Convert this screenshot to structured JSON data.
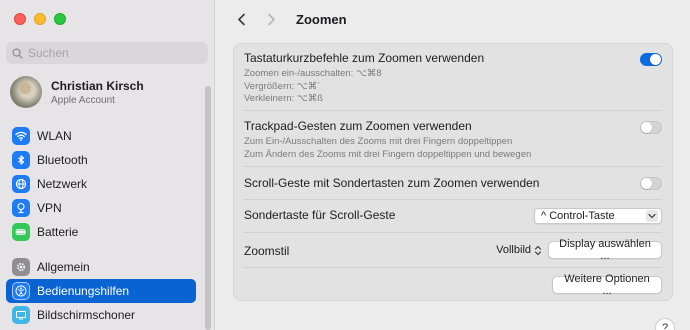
{
  "window": {
    "controls": [
      "close",
      "minimize",
      "zoom"
    ]
  },
  "sidebar": {
    "search": {
      "placeholder": "Suchen",
      "value": ""
    },
    "account": {
      "name": "Christian Kirsch",
      "subtitle": "Apple Account"
    },
    "items": [
      {
        "label": "WLAN",
        "icon": "wifi-icon",
        "color": "#1f7cf5"
      },
      {
        "label": "Bluetooth",
        "icon": "bluetooth-icon",
        "color": "#1f7cf5"
      },
      {
        "label": "Netzwerk",
        "icon": "globe-icon",
        "color": "#1f7cf5"
      },
      {
        "label": "VPN",
        "icon": "vpn-icon",
        "color": "#1f7cf5"
      },
      {
        "label": "Batterie",
        "icon": "battery-icon",
        "color": "#34c759"
      },
      {
        "label": "Allgemein",
        "icon": "gear-icon",
        "color": "#8e8e93"
      },
      {
        "label": "Bedienungshilfen",
        "icon": "accessibility-icon",
        "color": "#1f7cf5",
        "active": true
      },
      {
        "label": "Bildschirmschoner",
        "icon": "screensaver-icon",
        "color": "#3fb6e6"
      }
    ]
  },
  "header": {
    "title": "Zoomen"
  },
  "settings": {
    "keyboard_shortcuts": {
      "title": "Tastaturkurzbefehle zum Zoomen verwenden",
      "lines": [
        "Zoomen ein-/ausschalten: ⌥⌘8",
        "Vergrößern: ⌥⌘´",
        "Verkleinern: ⌥⌘ß"
      ],
      "enabled": true
    },
    "trackpad": {
      "title": "Trackpad-Gesten zum Zoomen verwenden",
      "lines": [
        "Zum Ein-/Ausschalten des Zooms mit drei Fingern doppeltippen",
        "Zum Ändern des Zooms mit drei Fingern doppeltippen und bewegen"
      ],
      "enabled": false
    },
    "scroll_gesture": {
      "title": "Scroll-Geste mit Sondertasten zum Zoomen verwenden",
      "enabled": false
    },
    "modifier_key": {
      "title": "Sondertaste für Scroll-Geste",
      "value": "^ Control-Taste"
    },
    "zoom_style": {
      "title": "Zoomstil",
      "value": "Vollbild",
      "button": "Display auswählen ..."
    },
    "more_options": {
      "button": "Weitere Optionen ..."
    }
  },
  "help": {
    "label": "?"
  },
  "colors": {
    "accent": "#0a63d3",
    "toggle_on": "#0a6ce0"
  }
}
